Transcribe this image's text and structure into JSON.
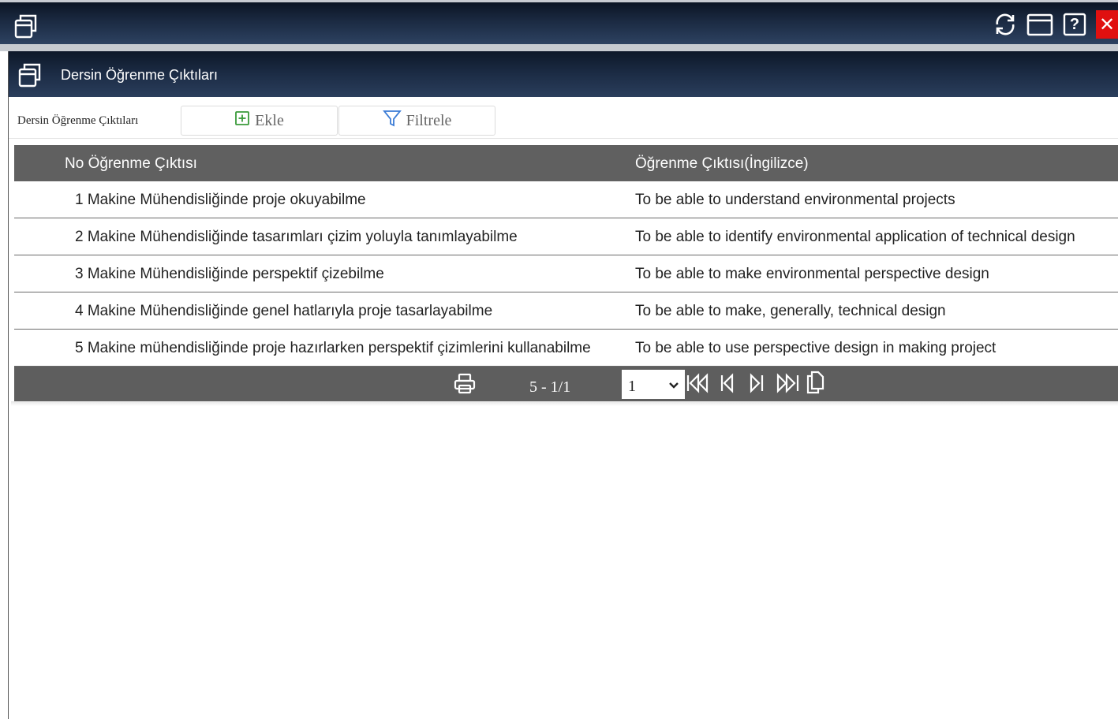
{
  "window": {
    "icons": [
      "window-stack-icon",
      "refresh-icon",
      "maximize-icon",
      "help-icon",
      "close-icon"
    ],
    "help_label": "?",
    "close_label": "✕"
  },
  "panel": {
    "title": "Dersin Öğrenme Çıktıları"
  },
  "toolbar": {
    "label": "Dersin Öğrenme Çıktıları",
    "add_label": "Ekle",
    "filter_label": "Filtrele"
  },
  "grid": {
    "columns": [
      "No Öğrenme Çıktısı",
      "Öğrenme Çıktısı(İngilizce)"
    ],
    "rows": [
      {
        "tr": "1 Makine Mühendisliğinde proje okuyabilme",
        "en": "To be able to understand environmental projects"
      },
      {
        "tr": "2 Makine Mühendisliğinde tasarımları çizim yoluyla tanımlayabilme",
        "en": "To be able to identify environmental application of technical design"
      },
      {
        "tr": "3 Makine Mühendisliğinde perspektif çizebilme",
        "en": "To be able to make environmental perspective design"
      },
      {
        "tr": "4 Makine Mühendisliğinde genel hatlarıyla proje tasarlayabilme",
        "en": "To be able to make, generally, technical design"
      },
      {
        "tr": "5 Makine mühendisliğinde proje hazırlarken perspektif çizimlerini kullanabilme",
        "en": "To be able to use perspective design in making project"
      }
    ]
  },
  "pager": {
    "count": "5 - 1/1",
    "selected_page": "1",
    "icons": [
      "print-icon",
      "first-page-icon",
      "prev-page-icon",
      "next-page-icon",
      "last-page-icon",
      "copy-icon"
    ]
  },
  "colors": {
    "header_dark": "#1c2c45",
    "grid_header": "#606060",
    "close_red": "#e01010",
    "add_green": "#3a9a3a",
    "filter_blue": "#3a7bd5"
  }
}
